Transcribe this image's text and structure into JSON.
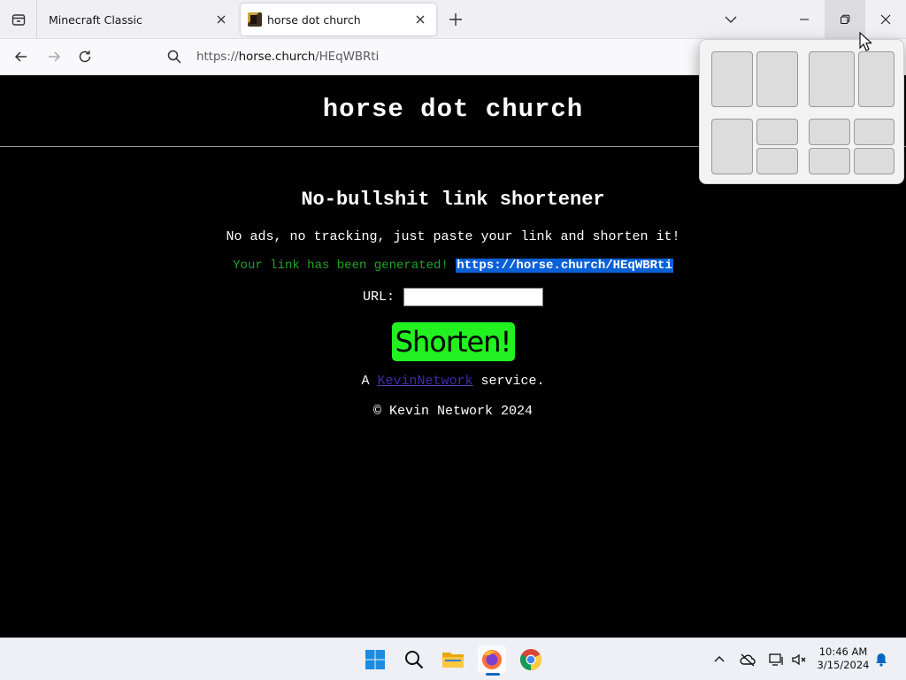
{
  "browser": {
    "tabs": [
      {
        "title": "Minecraft Classic",
        "active": false
      },
      {
        "title": "horse dot church",
        "active": true
      }
    ],
    "url_prefix": "https://",
    "url_host": "horse.church",
    "url_path": "/HEqWBRti"
  },
  "page": {
    "site_title": "horse dot church",
    "heading": "No-bullshit link shortener",
    "tagline": "No ads, no tracking, just paste your link and shorten it!",
    "result_message": "Your link has been generated!",
    "result_link": "https://horse.church/HEqWBRti",
    "url_label": "URL:",
    "url_value": "",
    "shorten_label": "Shorten!",
    "footer_prefix": "A",
    "footer_link": "KevinNetwork",
    "footer_suffix": "service.",
    "copyright": "© Kevin Network 2024"
  },
  "taskbar": {
    "time": "10:46 AM",
    "date": "3/15/2024"
  },
  "colors": {
    "success_green": "#22a32a",
    "button_green": "#22f020",
    "selection_blue": "#0a61d6",
    "link_purple": "#3d2aa8"
  }
}
